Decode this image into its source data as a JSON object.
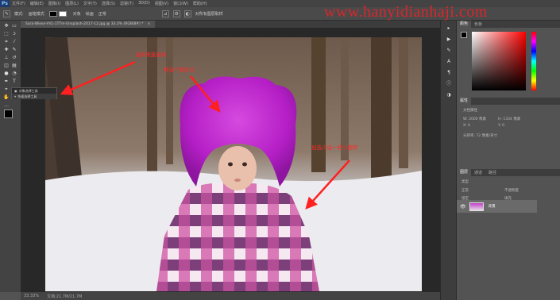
{
  "menubar": {
    "app_icon": "Ps",
    "items": [
      "文件(F)",
      "编辑(E)",
      "图像(I)",
      "图层(L)",
      "文字(Y)",
      "选择(S)",
      "滤镜(T)",
      "3D(D)",
      "视图(V)",
      "窗口(W)",
      "帮助(H)"
    ]
  },
  "options_bar": {
    "mode_label": "模式:",
    "mode_value": "画笔模式",
    "label_a": "对象",
    "label_b": "绘画",
    "dropdown": "正常",
    "check_label": "对所有图层取样"
  },
  "watermark": "www.hanyidianhaji.com",
  "document": {
    "tab_title": "Sara-Wiese-VVL-1TTm-Unsplash-2017-12.jpg @ 33.3% (RGB/8#) *"
  },
  "tool_flyout": {
    "items": [
      "对象选择工具",
      "快速选择工具"
    ]
  },
  "annotations": {
    "a1": "选择快速选择",
    "a2": "框选个要区分",
    "a3": "加选少选一些小面积"
  },
  "status_bar": {
    "zoom": "33.33%",
    "info": "文档:21.7M/21.7M"
  },
  "color_panel": {
    "tabs": [
      "颜色",
      "色板"
    ],
    "accent": "#ff0000"
  },
  "properties_panel": {
    "tabs": [
      "属性"
    ],
    "title": "文档属性",
    "rows": [
      "W: 2000 像素",
      "H: 1334 像素",
      "X: 0",
      "Y: 0",
      "分辨率: 72 像素/英寸"
    ]
  },
  "layers_panel": {
    "tabs": [
      "图层",
      "通道",
      "路径"
    ],
    "kind_label": "类型",
    "blend_mode": "正常",
    "opacity_label": "不透明度",
    "lock_label": "锁定",
    "fill_label": "填充",
    "layer_name": "背景"
  },
  "colors": {
    "foreground": "#000000",
    "background": "#ffffff"
  }
}
